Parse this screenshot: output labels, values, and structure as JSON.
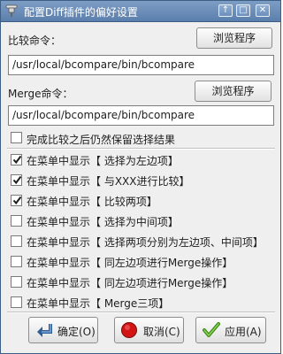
{
  "window": {
    "title": "配置Diff插件的偏好设置",
    "controls": [
      "↑",
      "□",
      "✕"
    ]
  },
  "compare": {
    "label": "比较命令：",
    "browse_label": "浏览程序",
    "path": "/usr/local/bcompare/bin/bcompare"
  },
  "merge": {
    "label": "Merge命令：",
    "browse_label": "浏览程序",
    "path": "/usr/local/bcompare/bin/bcompare"
  },
  "options": [
    {
      "label": "完成比较之后仍然保留选择结果",
      "checked": false
    },
    {
      "label": "在菜单中显示【 选择为左边项】",
      "checked": true
    },
    {
      "label": "在菜单中显示【 与XXX进行比较】",
      "checked": true
    },
    {
      "label": "在菜单中显示【 比较两项】",
      "checked": true
    },
    {
      "label": "在菜单中显示【 选择为中间项】",
      "checked": false
    },
    {
      "label": "在菜单中显示【 选择两项分别为左边项、中间项】",
      "checked": false
    },
    {
      "label": "在菜单中显示【 同左边项进行Merge操作】",
      "checked": false
    },
    {
      "label": "在菜单中显示【 同左边项进行Merge操作】",
      "checked": false
    },
    {
      "label": "在菜单中显示【 Merge三项】",
      "checked": false
    }
  ],
  "buttons": {
    "ok": "确定(O)",
    "cancel": "取消(C)",
    "apply": "应用(A)"
  }
}
